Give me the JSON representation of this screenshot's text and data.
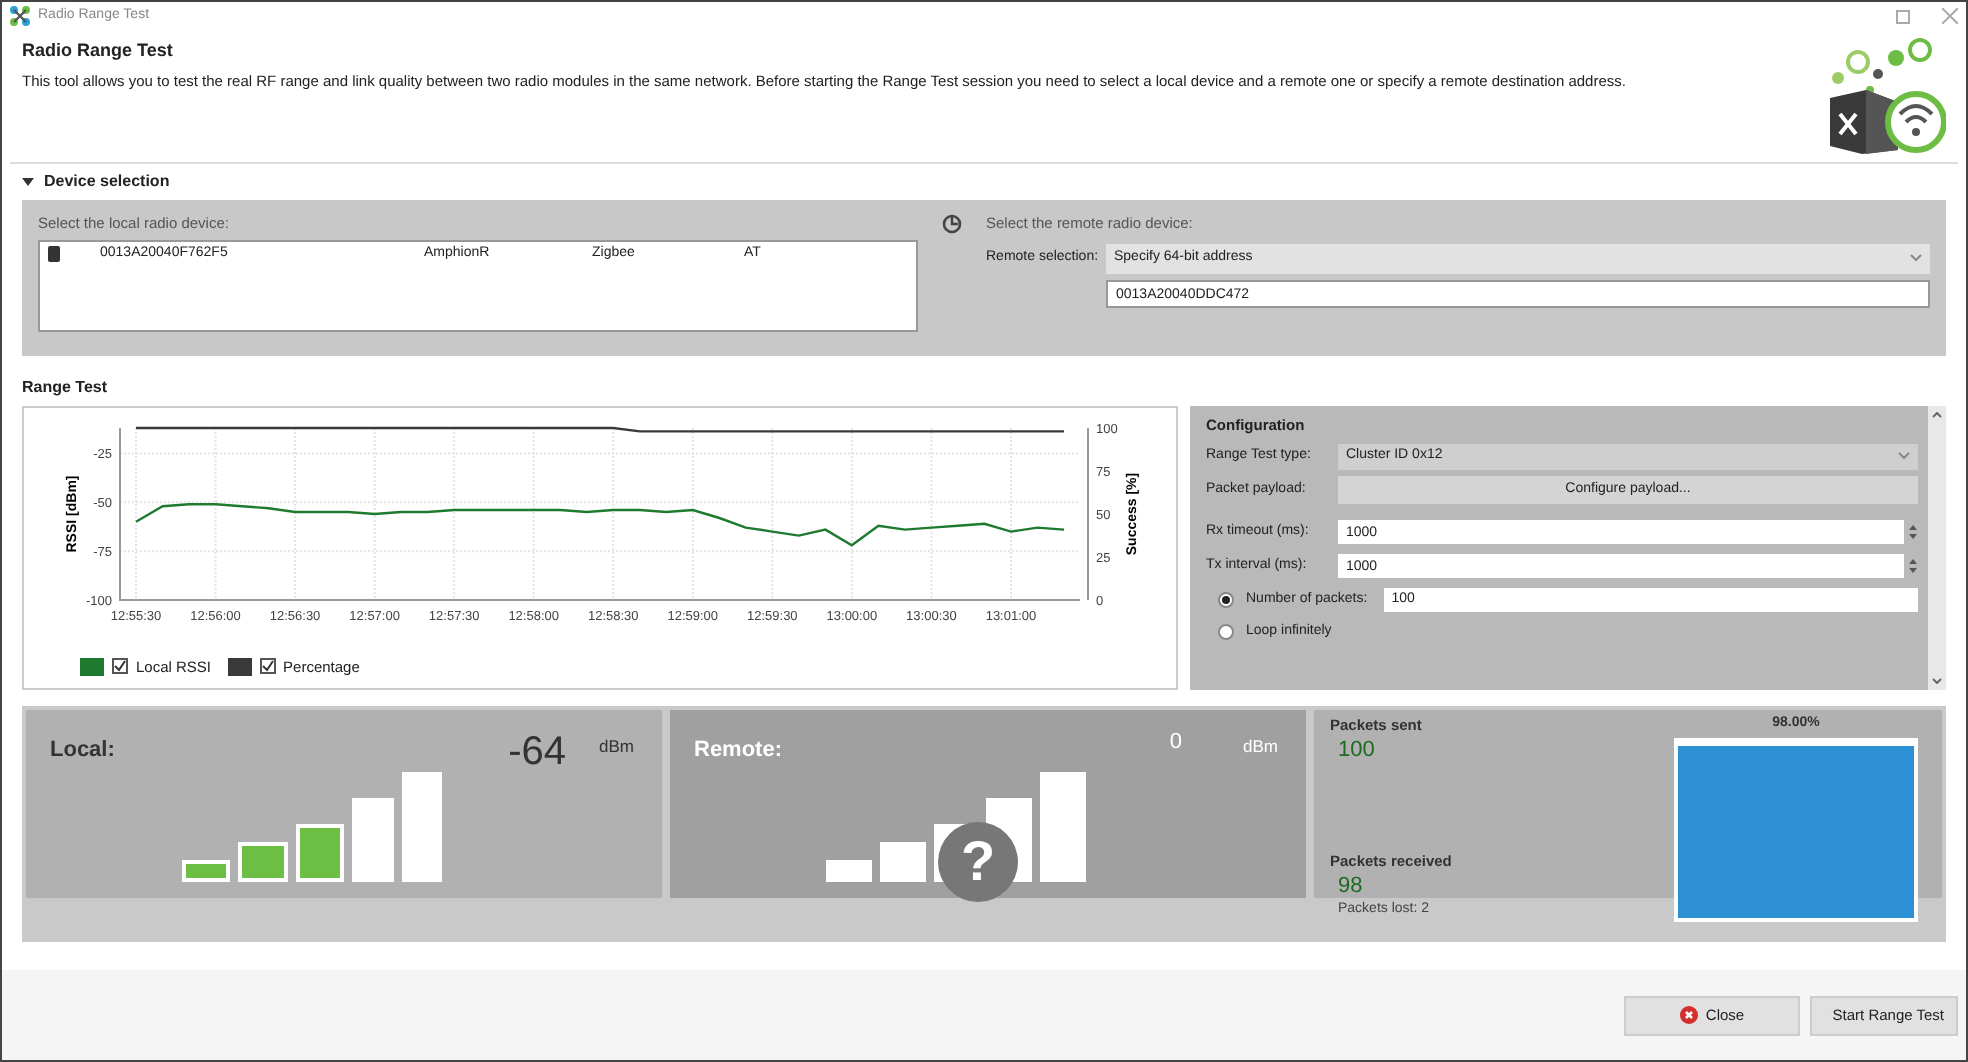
{
  "window": {
    "title": "Radio Range Test"
  },
  "header": {
    "title": "Radio Range Test",
    "description": "This tool allows you to test the real RF range and link quality between two radio modules in the same network. Before starting the Range Test session you need to select a local device and a remote one or specify a remote destination address."
  },
  "device_selection": {
    "title": "Device selection",
    "expanded": true,
    "local_label": "Select the local radio device:",
    "devices": [
      {
        "address": "0013A20040F762F5",
        "name": "AmphionR",
        "protocol": "Zigbee",
        "mode": "AT"
      }
    ],
    "remote_label": "Select the remote radio device:",
    "remote_selection_label": "Remote selection:",
    "remote_selection": "Specify 64-bit address",
    "remote_address": "0013A20040DDC472"
  },
  "range_test": {
    "title": "Range Test",
    "chart_data": {
      "type": "line",
      "grid": true,
      "ylabel": "RSSI [dBm]",
      "ylim": [
        -100,
        -12
      ],
      "yticks": [
        -100,
        -75,
        -50,
        -25
      ],
      "y2label": "Success [%]",
      "y2lim": [
        0,
        100
      ],
      "y2ticks": [
        0,
        25,
        50,
        75,
        100
      ],
      "categories": [
        "12:55:30",
        null,
        null,
        "12:56:00",
        null,
        null,
        "12:56:30",
        null,
        null,
        "12:57:00",
        null,
        null,
        "12:57:30",
        null,
        null,
        "12:58:00",
        null,
        null,
        "12:58:30",
        null,
        null,
        "12:59:00",
        null,
        null,
        "12:59:30",
        null,
        null,
        "13:00:00",
        null,
        null,
        "13:00:30",
        null,
        null,
        "13:01:00",
        null,
        null
      ],
      "series": [
        {
          "name": "Local RSSI",
          "color": "#1e7a2e",
          "values": [
            -60,
            -52,
            -51,
            -51,
            -52,
            -53,
            -55,
            -55,
            -55,
            -56,
            -55,
            -55,
            -54,
            -54,
            -54,
            -54,
            -54,
            -55,
            -54,
            -54,
            -55,
            -54,
            -58,
            -63,
            -65,
            -67,
            -64,
            -72,
            -62,
            -64,
            -63,
            -62,
            -61,
            -65,
            -63,
            -64
          ]
        },
        {
          "name": "Percentage",
          "color": "#3a3a3a",
          "axis": "y2",
          "values": [
            100,
            100,
            100,
            100,
            100,
            100,
            100,
            100,
            100,
            100,
            100,
            100,
            100,
            100,
            100,
            100,
            100,
            100,
            100,
            98,
            98,
            98,
            98,
            98,
            98,
            98,
            98,
            98,
            98,
            98,
            98,
            98,
            98,
            98,
            98,
            98
          ]
        }
      ]
    },
    "legend": [
      {
        "checked": true
      },
      {
        "checked": true
      }
    ],
    "configuration": {
      "title": "Configuration",
      "type_label": "Range Test type:",
      "type_value": "Cluster ID 0x12",
      "payload_label": "Packet payload:",
      "payload_button": "Configure payload...",
      "rx_label": "Rx timeout (ms):",
      "rx_value": "1000",
      "tx_label": "Tx interval (ms):",
      "tx_value": "1000",
      "modes": [
        {
          "label": "Number of packets:",
          "selected": true,
          "value": "100"
        },
        {
          "label": "Loop infinitely",
          "selected": false
        }
      ]
    }
  },
  "local": {
    "label": "Local:",
    "value": "-64",
    "unit": "dBm",
    "bars": [
      {
        "on": true
      },
      {
        "on": true
      },
      {
        "on": true
      },
      {
        "on": false
      },
      {
        "on": false
      }
    ]
  },
  "remote": {
    "label": "Remote:",
    "value": "0",
    "unit": "dBm",
    "unknown_icon": "?"
  },
  "stats": {
    "sent_label": "Packets sent",
    "sent": "100",
    "received_label": "Packets received",
    "received": "98",
    "lost": "Packets lost:  2",
    "percent": "98.00%",
    "level": 0.98
  },
  "buttons": [
    {
      "kind": "close",
      "label": "Close"
    },
    {
      "kind": "start",
      "label": "Start Range Test"
    }
  ]
}
